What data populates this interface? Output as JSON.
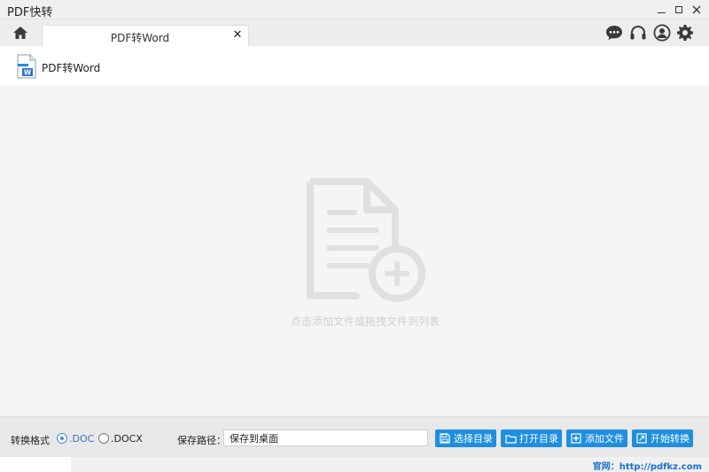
{
  "window": {
    "title": "PDF快转",
    "controls": {
      "minimize": "minimize-icon",
      "maximize": "maximize-icon",
      "close": "close-icon"
    }
  },
  "tabs": [
    {
      "label": "PDF转Word",
      "active": true
    }
  ],
  "tab_close_glyph": "✕",
  "top_icons": [
    "chat-icon",
    "headset-icon",
    "user-icon",
    "gear-icon"
  ],
  "subheader": {
    "title": "PDF转Word",
    "icon": "word-document-icon"
  },
  "dropzone": {
    "hint": "点击添加文件或拖拽文件到列表",
    "icon": "add-document-icon"
  },
  "bottom": {
    "format_label": "转换格式",
    "formats": [
      {
        "label": ".DOC",
        "selected": true
      },
      {
        "label": ".DOCX",
        "selected": false
      }
    ],
    "save_path_label": "保存路径：",
    "save_path_value": "保存到桌面",
    "buttons": {
      "select_dir": "选择目录",
      "open_dir": "打开目录",
      "add_file": "添加文件",
      "start": "开始转换"
    }
  },
  "footer": {
    "site": "官网：http://pdfkz.com"
  },
  "colors": {
    "accent": "#1e8fe0",
    "link": "#1a6fd0",
    "radio": "#3b8fd6"
  }
}
